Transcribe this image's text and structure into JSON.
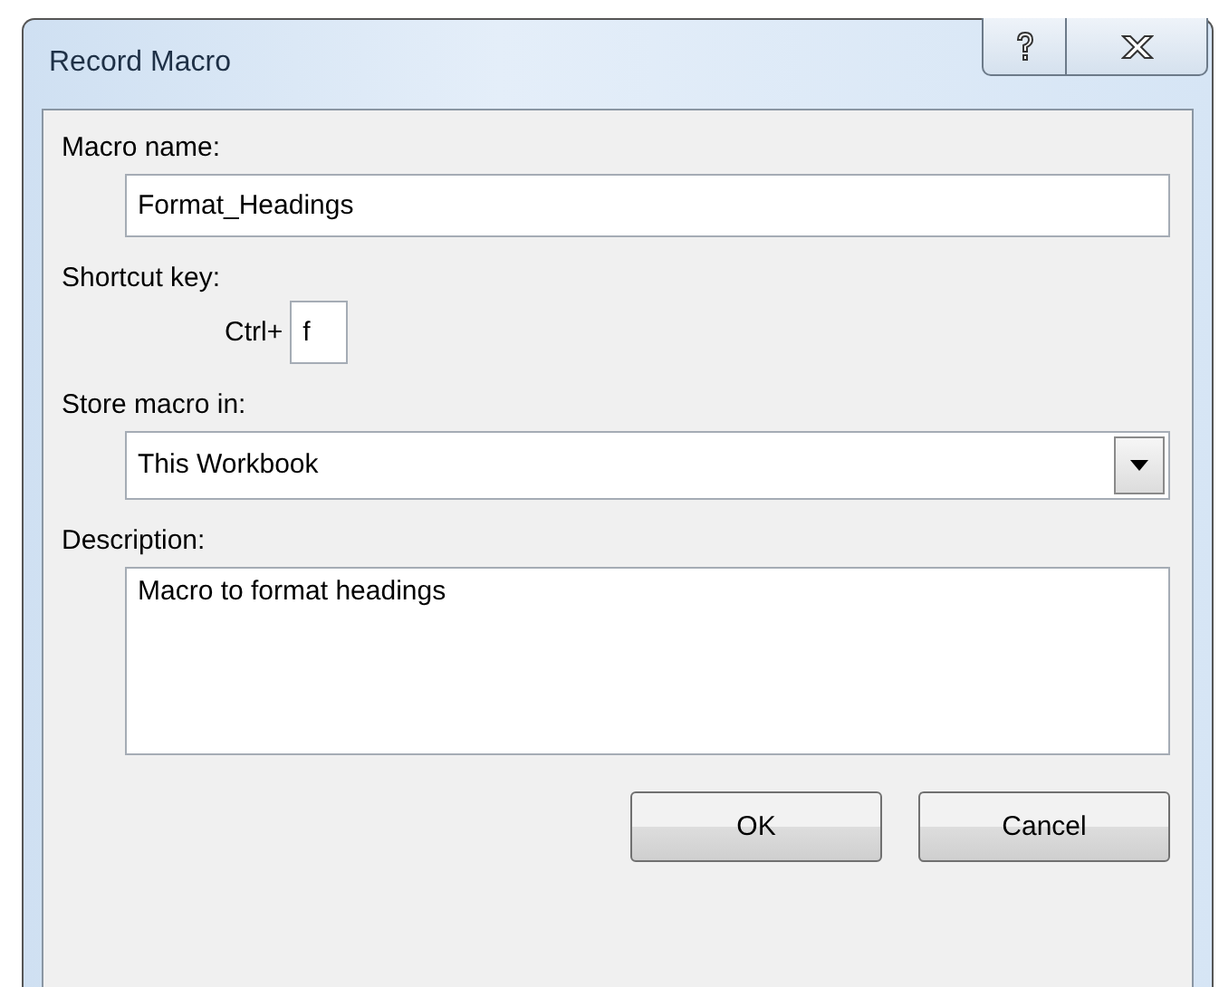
{
  "window": {
    "title": "Record Macro"
  },
  "fields": [
    {
      "kind": "text",
      "label": "Macro name:",
      "value": "Format_Headings"
    },
    {
      "kind": "shortcut",
      "label": "Shortcut key:",
      "prefix": "Ctrl+",
      "value": "f"
    },
    {
      "kind": "dropdown",
      "label": "Store macro in:",
      "value": "This Workbook"
    },
    {
      "kind": "multiline",
      "label": "Description:",
      "value": "Macro to format headings"
    }
  ],
  "buttons": [
    "OK",
    "Cancel"
  ]
}
